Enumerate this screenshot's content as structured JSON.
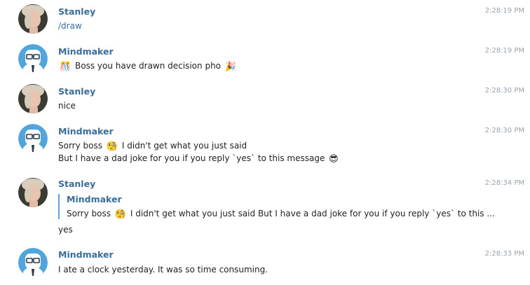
{
  "messages": [
    {
      "sender": "Stanley",
      "avatar": "user-photo-avatar",
      "time": "2:28:19 PM",
      "lines": [
        "/draw"
      ]
    },
    {
      "sender": "Mindmaker",
      "avatar": "bot-glasses-avatar",
      "time": "2:28:19 PM",
      "emoji_left": "🎊",
      "text": "Boss you have drawn decision pho",
      "emoji_right": "🎉"
    },
    {
      "sender": "Stanley",
      "avatar": "user-photo-avatar",
      "time": "2:28:30 PM",
      "lines": [
        "nice"
      ]
    },
    {
      "sender": "Mindmaker",
      "avatar": "bot-glasses-avatar",
      "time": "2:28:30 PM",
      "line1_a": "Sorry boss",
      "line1_emoji": "🧐",
      "line1_b": "I didn't get what you just said",
      "line2": "But I have a dad joke for you if you reply `yes` to this message",
      "line2_emoji": "😎"
    },
    {
      "sender": "Stanley",
      "avatar": "user-photo-avatar",
      "time": "2:28:34 PM",
      "reply_to": {
        "sender": "Mindmaker",
        "text_a": "Sorry boss",
        "emoji": "🧐",
        "text_b": "I didn't get what you just said But I have a dad joke for you if you reply `yes` to this ..."
      },
      "lines": [
        "yes"
      ]
    },
    {
      "sender": "Mindmaker",
      "avatar": "bot-glasses-avatar",
      "time": "2:28:33 PM",
      "lines": [
        "I ate a clock yesterday. It was so time consuming."
      ]
    }
  ]
}
